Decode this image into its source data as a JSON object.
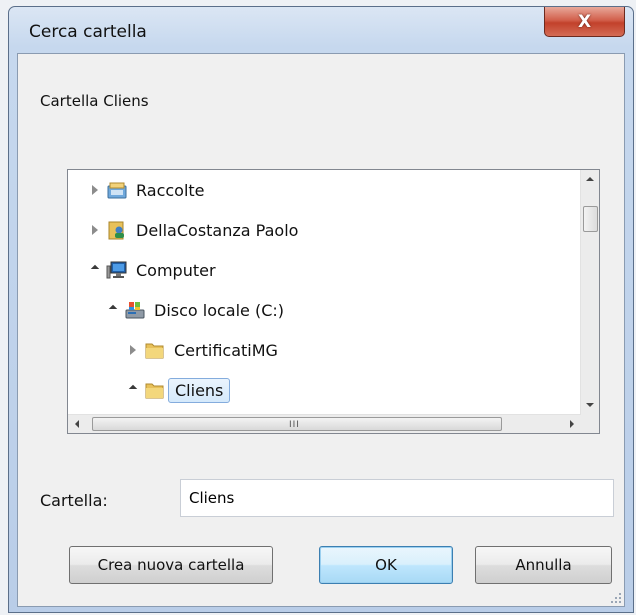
{
  "window": {
    "title": "Cerca cartella",
    "close_glyph": "X"
  },
  "description": "Cartella Cliens",
  "tree": {
    "items": [
      {
        "label": "Raccolte",
        "icon": "libraries-icon",
        "state": "collapsed"
      },
      {
        "label": "DellaCostanza Paolo",
        "icon": "user-folder-icon",
        "state": "collapsed"
      },
      {
        "label": "Computer",
        "icon": "computer-icon",
        "state": "expanded"
      },
      {
        "label": "Disco locale (C:)",
        "icon": "drive-icon",
        "state": "expanded"
      },
      {
        "label": "CertificatiMG",
        "icon": "folder-icon",
        "state": "collapsed"
      },
      {
        "label": "Cliens",
        "icon": "folder-icon",
        "state": "expanded",
        "selected": true
      }
    ],
    "hscroll_grip": "III"
  },
  "field": {
    "label": "Cartella:",
    "value": "Cliens"
  },
  "buttons": {
    "new_folder": "Crea nuova cartella",
    "ok": "OK",
    "cancel": "Annulla"
  },
  "colors": {
    "selection_border": "#84acdd",
    "close_button": "#c2412b",
    "folder": "#e8c15a"
  }
}
